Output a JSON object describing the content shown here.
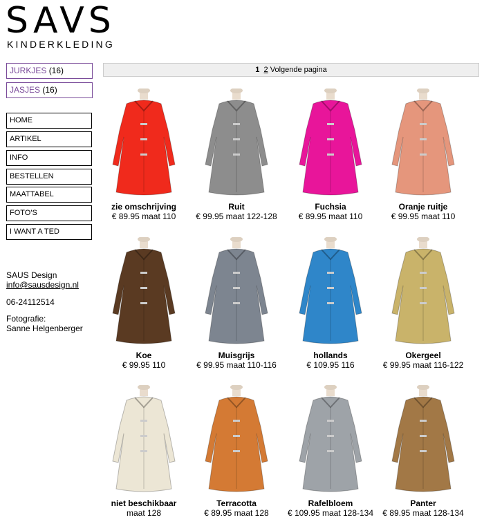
{
  "logo": {
    "main": "SAVS",
    "sub": "KINDERKLEDING"
  },
  "categories": [
    {
      "name": "JURKJES",
      "count": "(16)"
    },
    {
      "name": "JASJES",
      "count": "(16)"
    }
  ],
  "nav": [
    "HOME",
    "ARTIKEL",
    "INFO",
    "BESTELLEN",
    "MAATTABEL",
    "FOTO'S",
    "I WANT A TED"
  ],
  "contact": {
    "company": "SAUS Design",
    "email": "info@sausdesign.nl",
    "phone": "06-24112514",
    "photo_label": "Fotografie:",
    "photographer": "Sanne Helgenberger"
  },
  "pager": {
    "current": "1",
    "page2": "2",
    "next": "Volgende pagina"
  },
  "products": [
    {
      "name": "zie omschrijving",
      "price": "€ 89.95  maat 110",
      "color": "#f02a1c"
    },
    {
      "name": "Ruit",
      "price": "€ 99.95  maat 122-128",
      "color": "#8d8d8d"
    },
    {
      "name": "Fuchsia",
      "price": "€ 89.95  maat 110",
      "color": "#e8159a"
    },
    {
      "name": "Oranje ruitje",
      "price": "€ 99.95  maat 110",
      "color": "#e5967c"
    },
    {
      "name": "Koe",
      "price": "€ 99.95   110",
      "color": "#5a3a22"
    },
    {
      "name": "Muisgrijs",
      "price": "€ 99.95  maat 110-116",
      "color": "#7d8590"
    },
    {
      "name": "hollands",
      "price": "€ 109.95   116",
      "color": "#2f86c9"
    },
    {
      "name": "Okergeel",
      "price": "€ 99.95  maat 116-122",
      "color": "#c9b36a"
    },
    {
      "name": "niet beschikbaar",
      "price": "maat 128",
      "color": "#ece6d5"
    },
    {
      "name": "Terracotta",
      "price": "€ 89.95  maat 128",
      "color": "#d47a34"
    },
    {
      "name": "Rafelbloem",
      "price": "€ 109.95  maat 128-134",
      "color": "#9ea3a8"
    },
    {
      "name": "Panter",
      "price": "€ 89.95  maat 128-134",
      "color": "#a27846"
    }
  ]
}
